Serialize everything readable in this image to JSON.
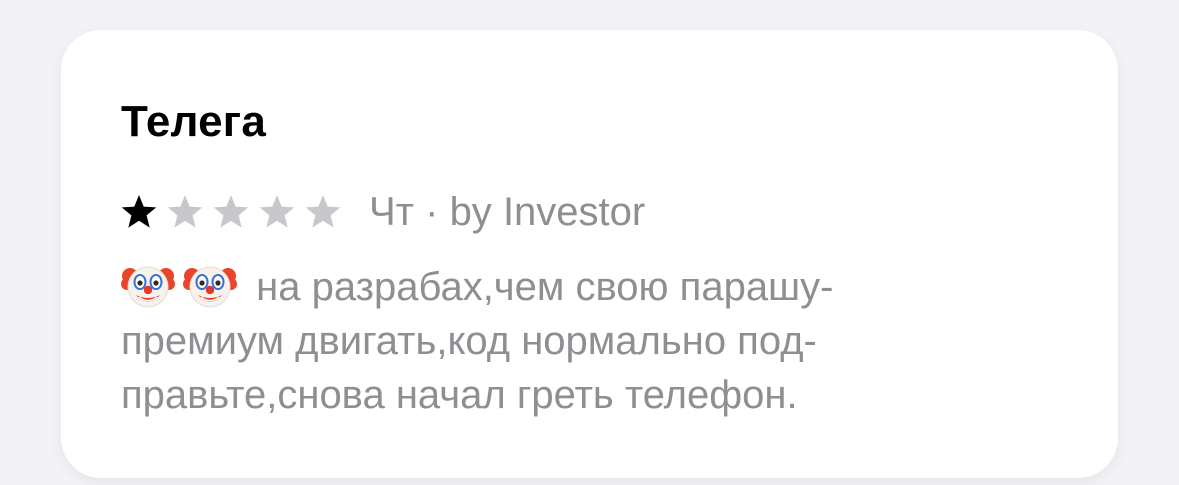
{
  "review": {
    "title": "Телега",
    "rating": 1,
    "max_rating": 5,
    "star_filled_color": "#000000",
    "star_empty_color": "#c7c7cc",
    "date": "Чт",
    "separator": "·",
    "author_prefix": "by",
    "author": "Investor",
    "emoji": [
      "clown-face-icon",
      "clown-face-icon"
    ],
    "body_lines": [
      "на разрабах,чем свою парашу-",
      "премиум двигать,код нормально под-",
      "правьте,снова начал греть телефон."
    ]
  }
}
